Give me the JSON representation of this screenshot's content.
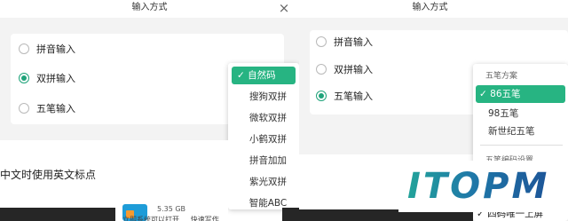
{
  "left_dialog": {
    "title": "输入方式",
    "options": [
      {
        "label": "拼音输入",
        "selected": false
      },
      {
        "label": "双拼输入",
        "selected": true
      },
      {
        "label": "五笔输入",
        "selected": false
      }
    ],
    "shuangpin_dropdown": {
      "items": [
        "自然码",
        "搜狗双拼",
        "微软双拼",
        "小鹤双拼",
        "拼音加加",
        "紫光双拼",
        "智能ABC"
      ],
      "selected": "自然码",
      "check_mark": "✓"
    },
    "partial_setting_text": "中文时使用英文标点",
    "file_size_text": "5.35 GB",
    "partial_bottom_text": "立即系统可以打开 ... 快速写作 ... 一键设置"
  },
  "right_dialog": {
    "title": "输入方式",
    "options": [
      {
        "label": "拼音输入",
        "selected": false
      },
      {
        "label": "双拼输入",
        "selected": false
      },
      {
        "label": "五笔输入",
        "selected": true
      }
    ],
    "wubi_dropdown": {
      "header": "五笔方案",
      "items": [
        "86五笔",
        "98五笔",
        "新世纪五笔"
      ],
      "selected": "86五笔",
      "check_mark": "✓",
      "section_header_partial": "五笔编码设置",
      "bottom_item": "四码唯一上屏",
      "bottom_checked": true
    }
  },
  "watermark": {
    "text": "ITOPM"
  },
  "colors": {
    "accent": "#27b482",
    "radio": "#1fa37a",
    "logo_blue": "#1f6f9e",
    "logo_teal": "#26a899"
  }
}
